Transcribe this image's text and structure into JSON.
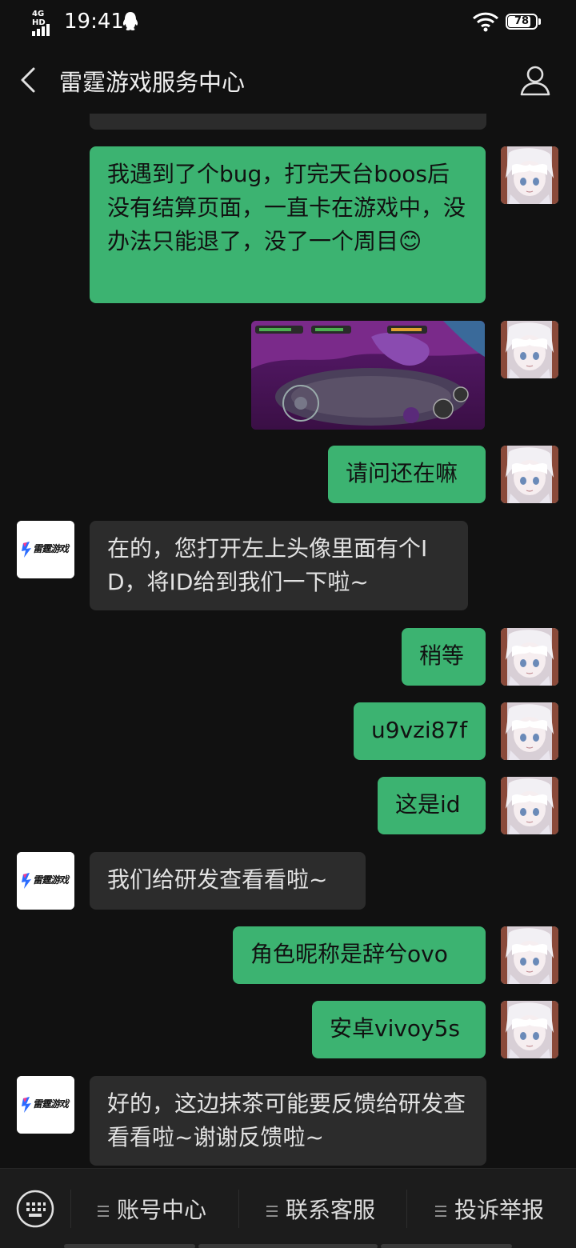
{
  "status_bar": {
    "network": "4G HD",
    "time": "19:41",
    "battery": "78"
  },
  "header": {
    "title": "雷霆游戏服务中心"
  },
  "messages": [
    {
      "side": "out",
      "text": "我遇到了个bug，打完天台boos后没有结算页面，一直卡在游戏中，没办法只能退了，没了一个周目😊"
    },
    {
      "side": "out",
      "type": "image"
    },
    {
      "side": "out",
      "text": "请问还在嘛"
    },
    {
      "side": "in",
      "text": "在的，您打开左上头像里面有个ID，将ID给到我们一下啦~"
    },
    {
      "side": "out",
      "text": "稍等"
    },
    {
      "side": "out",
      "text": "u9vzi87f"
    },
    {
      "side": "out",
      "text": "这是id"
    },
    {
      "side": "in",
      "text": "我们给研发查看看啦~"
    },
    {
      "side": "out",
      "text": "角色昵称是辞兮ovo"
    },
    {
      "side": "out",
      "text": "安卓vivoy5s"
    },
    {
      "side": "in",
      "text": "好的，这边抹茶可能要反馈给研发查看看啦~谢谢反馈啦~"
    }
  ],
  "service_avatar_label": "雷霆游戏",
  "bottom_menu": {
    "items": [
      "账号中心",
      "联系客服",
      "投诉举报"
    ]
  },
  "colors": {
    "background": "#111111",
    "outgoing_bubble": "#3cb371",
    "incoming_bubble": "#2c2c2c"
  }
}
